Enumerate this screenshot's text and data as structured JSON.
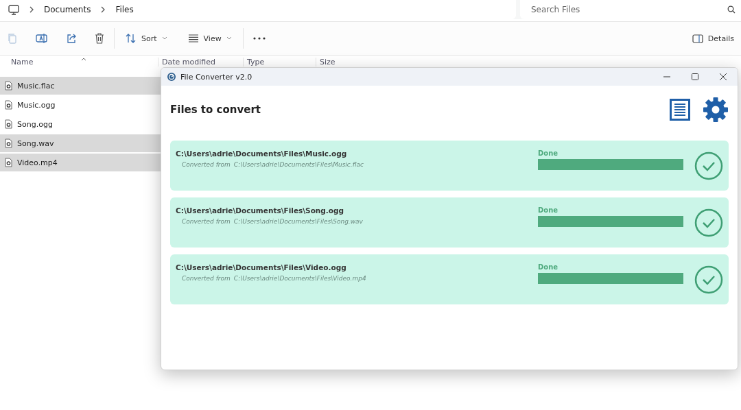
{
  "breadcrumb": [
    "Documents",
    "Files"
  ],
  "search": {
    "placeholder": "Search Files"
  },
  "toolbar": {
    "sort": "Sort",
    "view": "View",
    "details": "Details"
  },
  "table": {
    "columns": [
      "Name",
      "Date modified",
      "Type",
      "Size"
    ],
    "rows": [
      {
        "name": "Music.flac",
        "selected": true
      },
      {
        "name": "Music.ogg",
        "selected": false
      },
      {
        "name": "Song.ogg",
        "selected": false
      },
      {
        "name": "Song.wav",
        "selected": true
      },
      {
        "name": "Video.mp4",
        "selected": true
      }
    ]
  },
  "dialog": {
    "title": "File Converter v2.0",
    "heading": "Files to convert",
    "jobs": [
      {
        "output": "C:\\Users\\adrie\\Documents\\Files\\Music.ogg",
        "source_label": "Converted from",
        "source": "C:\\Users\\adrie\\Documents\\Files\\Music.flac",
        "status": "Done",
        "level": 1,
        "done": true
      },
      {
        "output": "C:\\Users\\adrie\\Documents\\Files\\Song.ogg",
        "source_label": "Converted from",
        "source": "C:\\Users\\adrie\\Documents\\Files\\Song.wav",
        "status": "Done",
        "level": 1,
        "done": true
      },
      {
        "output": "C:\\Users\\adrie\\Documents\\Files\\Video.ogg",
        "source_label": "Converted from",
        "source": "C:\\Users\\adrie\\Documents\\Files\\Video.mp4",
        "status": "Done",
        "level": 1,
        "done": true
      }
    ]
  }
}
